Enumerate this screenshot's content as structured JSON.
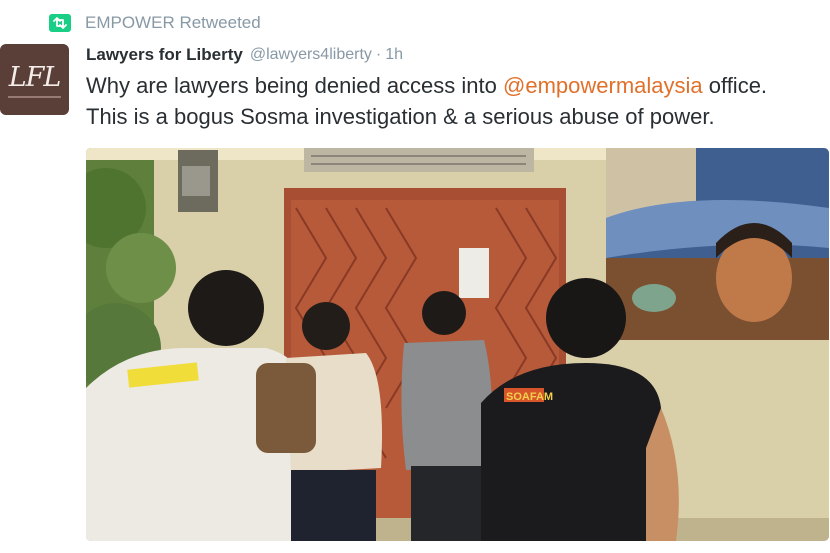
{
  "retweet": {
    "label": "EMPOWER Retweeted",
    "icon": "retweet-icon"
  },
  "author": {
    "name": "Lawyers for Liberty",
    "handle": "@lawyers4liberty",
    "separator": "·",
    "time": "1h",
    "avatar_monogram": "LFL"
  },
  "tweet": {
    "line1_prefix": "Why are lawyers being denied access into ",
    "mention": "@empowermalaysia",
    "line1_suffix": " office.",
    "line2": "This is a bogus Sosma investigation & a serious abuse of power."
  },
  "photo": {
    "shirt_print": "SOAFAM"
  },
  "colors": {
    "accent": "#e0712b",
    "muted": "#8899a6",
    "text": "#292f33",
    "retweet_green": "#19cf86"
  }
}
